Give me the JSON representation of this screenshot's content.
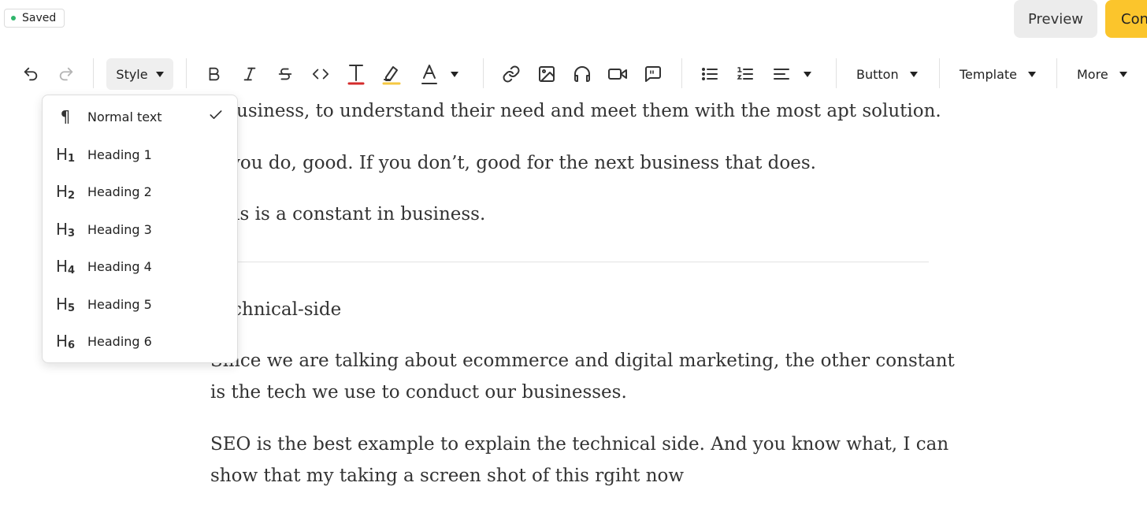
{
  "header": {
    "saved_label": "Saved",
    "preview_label": "Preview",
    "continue_label": "Con"
  },
  "toolbar": {
    "style_label": "Style",
    "button_label": "Button",
    "template_label": "Template",
    "more_label": "More"
  },
  "style_menu": {
    "items": [
      {
        "icon": "¶",
        "sub": "",
        "label": "Normal text",
        "selected": true
      },
      {
        "icon": "H",
        "sub": "1",
        "label": "Heading 1"
      },
      {
        "icon": "H",
        "sub": "2",
        "label": "Heading 2"
      },
      {
        "icon": "H",
        "sub": "3",
        "label": "Heading 3"
      },
      {
        "icon": "H",
        "sub": "4",
        "label": "Heading 4"
      },
      {
        "icon": "H",
        "sub": "5",
        "label": "Heading 5"
      },
      {
        "icon": "H",
        "sub": "6",
        "label": "Heading 6"
      }
    ]
  },
  "editor": {
    "p1": "r business, to understand their need and meet them with the most apt solution.",
    "p2": "If you do, good. If you don’t, good for the next business that does.",
    "p3": "This is a constant in business.",
    "p4": "Technical-side",
    "p5_line1": "Since we are talking about ecommerce and digital marketing, the other constant",
    "p5_line2": "is the tech we use to conduct our businesses.",
    "p6_line1": "SEO is the best example to explain the technical side. And you know what, I can",
    "p6_line2": "show that my taking a screen shot of this rgiht now"
  },
  "colors": {
    "accent": "#fbc52c",
    "saved_dot": "#2fb56b",
    "text_color_underline": "#d42b2b",
    "highlight_underline": "#f5c842"
  },
  "icons": [
    "undo-icon",
    "redo-icon",
    "bold-icon",
    "italic-icon",
    "strikethrough-icon",
    "code-icon",
    "text-color-icon",
    "highlight-icon",
    "font-color-icon",
    "link-icon",
    "image-icon",
    "audio-icon",
    "video-icon",
    "quote-icon",
    "bullet-list-icon",
    "numbered-list-icon",
    "align-icon",
    "check-icon"
  ]
}
